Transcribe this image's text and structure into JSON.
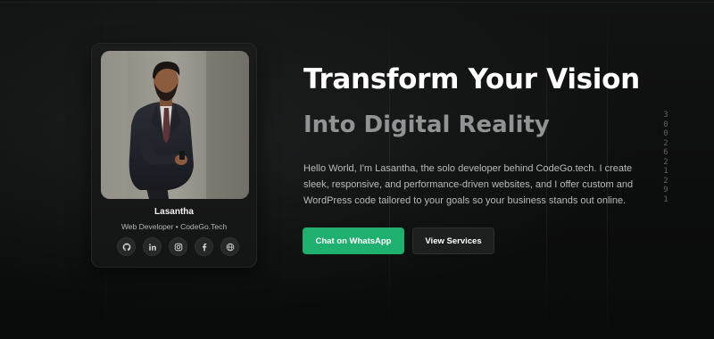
{
  "profile": {
    "name": "Lasantha",
    "role": "Web Developer • CodeGo.Tech",
    "socials": [
      {
        "icon": "github-icon"
      },
      {
        "icon": "linkedin-icon"
      },
      {
        "icon": "instagram-icon"
      },
      {
        "icon": "facebook-icon"
      },
      {
        "icon": "globe-icon"
      }
    ]
  },
  "hero": {
    "headline": "Transform Your Vision",
    "subheadline": "Into Digital Reality",
    "description": "Hello World, I'm Lasantha, the solo developer behind CodeGo.tech. I create sleek, responsive, and performance-driven websites, and I offer custom and WordPress code tailored to your goals so your business stands out online."
  },
  "actions": {
    "primary_label": "Chat on WhatsApp",
    "secondary_label": "View Services"
  },
  "decor": {
    "digits": [
      "3",
      "0",
      "0",
      "2",
      "6",
      "2",
      "1",
      "2",
      "9",
      "1"
    ]
  },
  "colors": {
    "background": "#0d0e0e",
    "accent": "#1faf6f",
    "subheadline": "#909494"
  }
}
